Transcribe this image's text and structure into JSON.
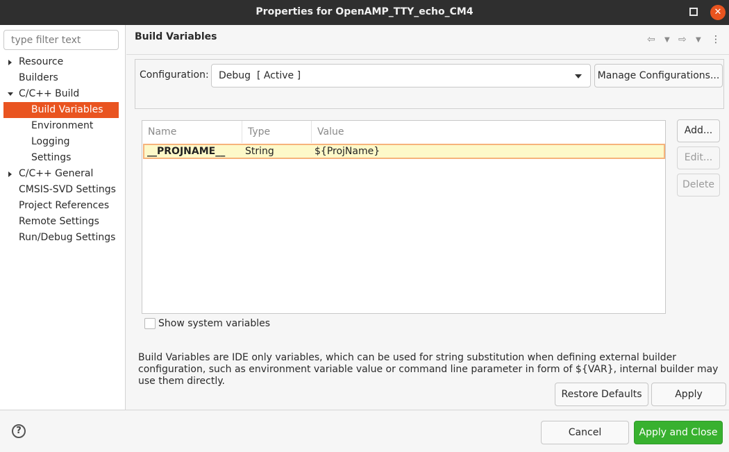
{
  "window": {
    "title": "Properties for OpenAMP_TTY_echo_CM4",
    "close_glyph": "✕"
  },
  "sidebar": {
    "filter_placeholder": "type filter text",
    "items": [
      {
        "label": "Resource",
        "expander": "collapsed"
      },
      {
        "label": "Builders"
      },
      {
        "label": "C/C++ Build",
        "expander": "expanded"
      },
      {
        "label": "Build Variables",
        "selected": true
      },
      {
        "label": "Environment"
      },
      {
        "label": "Logging"
      },
      {
        "label": "Settings"
      },
      {
        "label": "C/C++ General",
        "expander": "collapsed"
      },
      {
        "label": "CMSIS-SVD Settings"
      },
      {
        "label": "Project References"
      },
      {
        "label": "Remote Settings"
      },
      {
        "label": "Run/Debug Settings"
      }
    ]
  },
  "main": {
    "title": "Build Variables",
    "nav": {
      "back_icon": "back-arrow-icon",
      "forward_icon": "forward-arrow-icon",
      "menu_icon": "kebab-menu-icon"
    },
    "configuration": {
      "label": "Configuration:",
      "value": "Debug  [ Active ]",
      "manage_label": "Manage Configurations..."
    },
    "table": {
      "columns": [
        "Name",
        "Type",
        "Value"
      ],
      "rows": [
        {
          "name": "__PROJNAME__",
          "type": "String",
          "value": "${ProjName}"
        }
      ]
    },
    "buttons": {
      "add": "Add...",
      "edit": "Edit...",
      "delete": "Delete"
    },
    "show_system_label": "Show system variables",
    "description": "Build Variables are IDE only variables, which can be used for string substitution when defining external builder configuration, such as environment variable value or command line parameter in form of ${VAR}, internal builder may use them directly.",
    "restore_defaults": "Restore Defaults",
    "apply": "Apply"
  },
  "footer": {
    "help_glyph": "?",
    "cancel": "Cancel",
    "apply_and_close": "Apply and Close"
  },
  "colors": {
    "accent": "#e95420",
    "primary_button": "#38b12f",
    "row_highlight": "#fdf9c9"
  }
}
